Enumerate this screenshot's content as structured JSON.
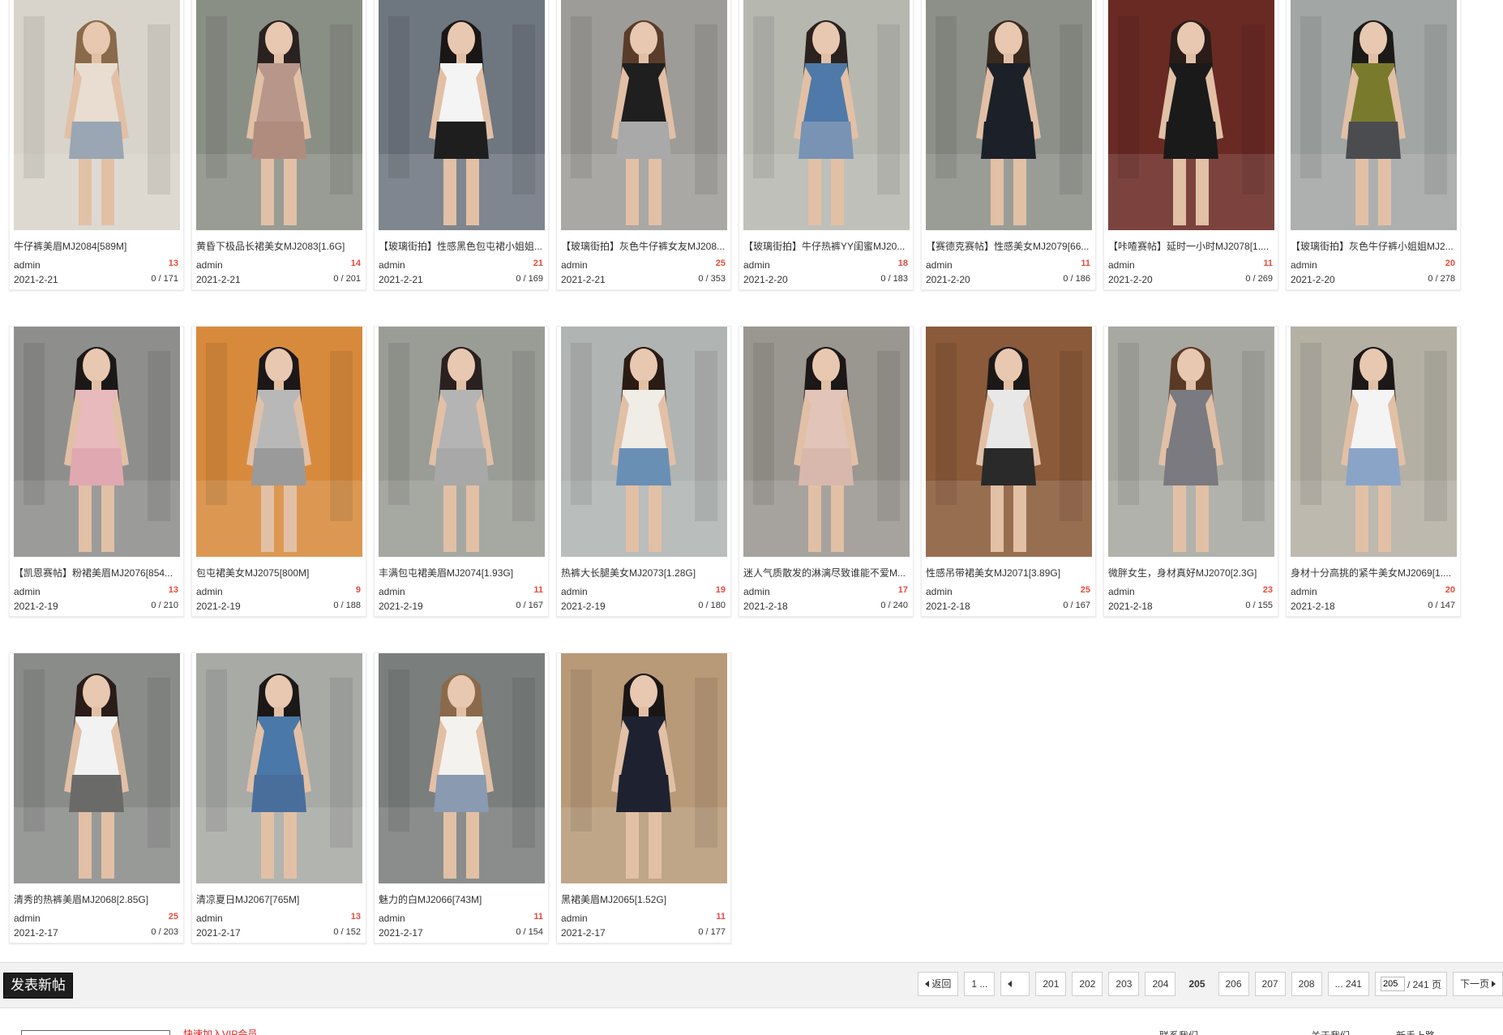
{
  "posts": [
    {
      "title": "牛仔裤美眉MJ2084[589M]",
      "author": "admin",
      "replies": "13",
      "date": "2021-2-21",
      "stats": "0 / 171",
      "colors": {
        "bg": "#d9d4cb",
        "top": "#e8ddd0",
        "bottom": "#9aa6b3",
        "hair": "#8a6a4a"
      }
    },
    {
      "title": "黄昏下极品长裙美女MJ2083[1.6G]",
      "author": "admin",
      "replies": "14",
      "date": "2021-2-21",
      "stats": "0 / 201",
      "colors": {
        "bg": "#8a8f86",
        "top": "#b8978a",
        "bottom": "#b08c7e",
        "hair": "#2a2220"
      }
    },
    {
      "title": "【玻璃街拍】性感黑色包屯裙小姐姐...",
      "author": "admin",
      "replies": "21",
      "date": "2021-2-21",
      "stats": "0 / 169",
      "colors": {
        "bg": "#6e7680",
        "top": "#f4f4f4",
        "bottom": "#1e1e1e",
        "hair": "#1a1616"
      }
    },
    {
      "title": "【玻璃街拍】灰色牛仔裤女友MJ208...",
      "author": "admin",
      "replies": "25",
      "date": "2021-2-21",
      "stats": "0 / 353",
      "colors": {
        "bg": "#9e9c98",
        "top": "#1f1f1f",
        "bottom": "#a9a9a9",
        "hair": "#5a3c2a"
      }
    },
    {
      "title": "【玻璃街拍】牛仔热裤YY闺蜜MJ20...",
      "author": "admin",
      "replies": "18",
      "date": "2021-2-20",
      "stats": "0 / 183",
      "colors": {
        "bg": "#b6b8b0",
        "top": "#4f79a8",
        "bottom": "#7893b4",
        "hair": "#2b2220"
      }
    },
    {
      "title": "【赛德克赛帖】性感美女MJ2079[66...",
      "author": "admin",
      "replies": "11",
      "date": "2021-2-20",
      "stats": "0 / 186",
      "colors": {
        "bg": "#8c9088",
        "top": "#1c2028",
        "bottom": "#1c2028",
        "hair": "#3a2a20"
      }
    },
    {
      "title": "【咔喳赛帖】延时一小时MJ2078[1....",
      "author": "admin",
      "replies": "11",
      "date": "2021-2-20",
      "stats": "0 / 269",
      "colors": {
        "bg": "#6a2a24",
        "top": "#1a1a1a",
        "bottom": "#1a1a1a",
        "hair": "#2a1c18"
      }
    },
    {
      "title": "【玻璃街拍】灰色牛仔裤小姐姐MJ2...",
      "author": "admin",
      "replies": "20",
      "date": "2021-2-20",
      "stats": "0 / 278",
      "colors": {
        "bg": "#a2a6a4",
        "top": "#7a7a2c",
        "bottom": "#4a4c50",
        "hair": "#1c1a18"
      }
    },
    {
      "title": "【凯恩赛帖】粉裙美眉MJ2076[854...",
      "author": "admin",
      "replies": "13",
      "date": "2021-2-19",
      "stats": "0 / 210",
      "colors": {
        "bg": "#8e8e8c",
        "top": "#e8b9bd",
        "bottom": "#e0a8b0",
        "hair": "#1c1818"
      }
    },
    {
      "title": "包屯裙美女MJ2075[800M]",
      "author": "admin",
      "replies": "9",
      "date": "2021-2-19",
      "stats": "0 / 188",
      "colors": {
        "bg": "#d88a3c",
        "top": "#b8b8b8",
        "bottom": "#9a9a9a",
        "hair": "#1c1818"
      }
    },
    {
      "title": "丰满包屯裙美眉MJ2074[1.93G]",
      "author": "admin",
      "replies": "11",
      "date": "2021-2-19",
      "stats": "0 / 167",
      "colors": {
        "bg": "#9a9c96",
        "top": "#b4b4b4",
        "bottom": "#a8a8a8",
        "hair": "#2a2020"
      }
    },
    {
      "title": "热裤大长腿美女MJ2073[1.28G]",
      "author": "admin",
      "replies": "19",
      "date": "2021-2-19",
      "stats": "0 / 180",
      "colors": {
        "bg": "#b0b4b2",
        "top": "#f0ece6",
        "bottom": "#6a8fb5",
        "hair": "#2a1c14"
      }
    },
    {
      "title": "迷人气质散发的淋漓尽致谁能不爱M...",
      "author": "admin",
      "replies": "17",
      "date": "2021-2-18",
      "stats": "0 / 240",
      "colors": {
        "bg": "#9a9690",
        "top": "#e2c4b8",
        "bottom": "#d8b8ac",
        "hair": "#1c1818"
      }
    },
    {
      "title": "性感吊带裙美女MJ2071[3.89G]",
      "author": "admin",
      "replies": "25",
      "date": "2021-2-18",
      "stats": "0 / 167",
      "colors": {
        "bg": "#8a5a3a",
        "top": "#e8e8e8",
        "bottom": "#2a2a2a",
        "hair": "#1c1818"
      }
    },
    {
      "title": "微胖女生，身材真好MJ2070[2.3G]",
      "author": "admin",
      "replies": "23",
      "date": "2021-2-18",
      "stats": "0 / 155",
      "colors": {
        "bg": "#a8a8a2",
        "top": "#7a7a80",
        "bottom": "#7a7a80",
        "hair": "#5a3a24"
      }
    },
    {
      "title": "身材十分高挑的紧牛美女MJ2069[1....",
      "author": "admin",
      "replies": "20",
      "date": "2021-2-18",
      "stats": "0 / 147",
      "colors": {
        "bg": "#b4b0a4",
        "top": "#f4f4f4",
        "bottom": "#8aa4c8",
        "hair": "#1c1818"
      }
    },
    {
      "title": "清秀的热裤美眉MJ2068[2.85G]",
      "author": "admin",
      "replies": "25",
      "date": "2021-2-17",
      "stats": "0 / 203",
      "colors": {
        "bg": "#8a8c8a",
        "top": "#f2f2f2",
        "bottom": "#6a6a68",
        "hair": "#2a1c18"
      }
    },
    {
      "title": "清凉夏日MJ2067[765M]",
      "author": "admin",
      "replies": "13",
      "date": "2021-2-17",
      "stats": "0 / 152",
      "colors": {
        "bg": "#a8aaa6",
        "top": "#4a78a8",
        "bottom": "#4a6e9c",
        "hair": "#1c1818"
      }
    },
    {
      "title": "魅力的白MJ2066[743M]",
      "author": "admin",
      "replies": "11",
      "date": "2021-2-17",
      "stats": "0 / 154",
      "colors": {
        "bg": "#7a7e7c",
        "top": "#f4f2ee",
        "bottom": "#8a9ab0",
        "hair": "#8a6a4a"
      }
    },
    {
      "title": "黑裙美眉MJ2065[1.52G]",
      "author": "admin",
      "replies": "11",
      "date": "2021-2-17",
      "stats": "0 / 177",
      "colors": {
        "bg": "#b89a78",
        "top": "#1e2230",
        "bottom": "#1e2230",
        "hair": "#1a1616"
      }
    }
  ],
  "toolbar": {
    "new_post": "发表新帖"
  },
  "pagination": {
    "back": "返回",
    "first": "1 ...",
    "pages": [
      "201",
      "202",
      "203",
      "204",
      "205",
      "206",
      "207",
      "208"
    ],
    "current": "205",
    "last": "... 241",
    "jump_value": "205",
    "total": "/ 241 页",
    "next": "下一页"
  },
  "footer": {
    "link": "快速加入VIP会员",
    "col1": "联系我们",
    "col2": "关于我们",
    "col3": "新手上路"
  }
}
